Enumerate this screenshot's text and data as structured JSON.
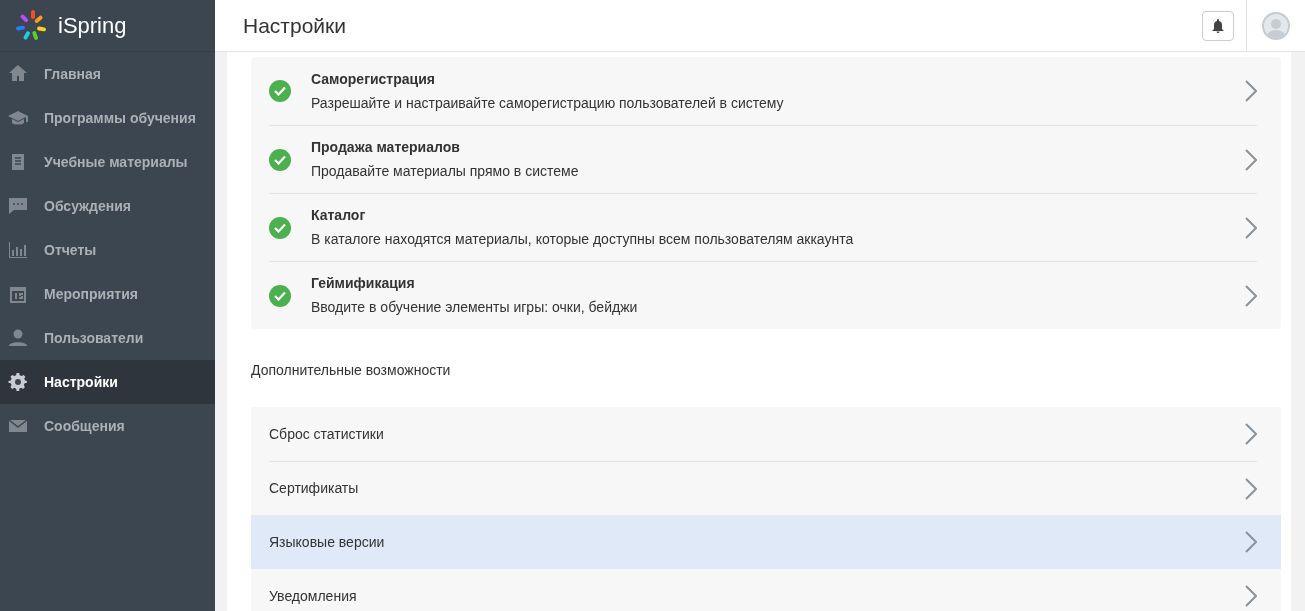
{
  "logo": {
    "text": "iSpring"
  },
  "sidebar": {
    "items": [
      {
        "label": "Главная",
        "selected": false
      },
      {
        "label": "Программы обучения",
        "selected": false
      },
      {
        "label": "Учебные материалы",
        "selected": false
      },
      {
        "label": "Обсуждения",
        "selected": false
      },
      {
        "label": "Отчеты",
        "selected": false
      },
      {
        "label": "Мероприятия",
        "selected": false
      },
      {
        "label": "Пользователи",
        "selected": false
      },
      {
        "label": "Настройки",
        "selected": true
      },
      {
        "label": "Сообщения",
        "selected": false
      }
    ]
  },
  "header": {
    "title": "Настройки"
  },
  "features": [
    {
      "title": "Саморегистрация",
      "description": "Разрешайте и настраивайте саморегистрацию пользователей в систему",
      "enabled": true
    },
    {
      "title": "Продажа материалов",
      "description": "Продавайте материалы прямо в системе",
      "enabled": true
    },
    {
      "title": "Каталог",
      "description": "В каталоге находятся материалы, которые доступны всем пользователям аккаунта",
      "enabled": true
    },
    {
      "title": "Геймификация",
      "description": "Вводите в обучение элементы игры: очки, бейджи",
      "enabled": true
    }
  ],
  "extra": {
    "heading": "Дополнительные возможности",
    "items": [
      {
        "label": "Сброс статистики",
        "hovered": false
      },
      {
        "label": "Сертификаты",
        "hovered": false
      },
      {
        "label": "Языковые версии",
        "hovered": true
      },
      {
        "label": "Уведомления",
        "hovered": false
      }
    ]
  }
}
